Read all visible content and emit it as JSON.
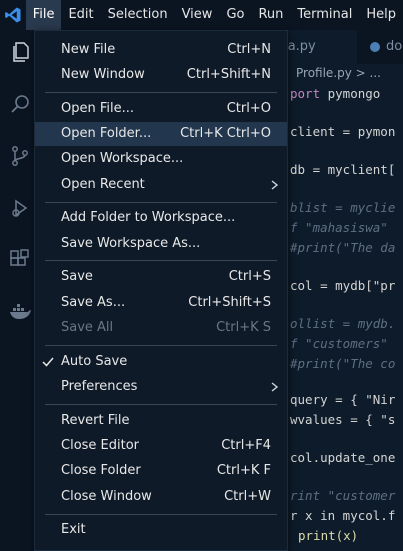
{
  "menubar": {
    "items": [
      "File",
      "Edit",
      "Selection",
      "View",
      "Go",
      "Run",
      "Terminal",
      "Help"
    ],
    "active": "File"
  },
  "tabs": [
    {
      "label": "va.py"
    },
    {
      "label": "doc"
    }
  ],
  "breadcrumb": "Profile.py > ...",
  "editor_lines": [
    {
      "text": "port pymongo"
    },
    {
      "text": "client = pymon"
    },
    {
      "text": "db = myclient["
    },
    {
      "text": "blist = myclie"
    },
    {
      "text": "f \"mahasiswa\""
    },
    {
      "text": "#print(\"The da"
    },
    {
      "text": "col = mydb[\"pr"
    },
    {
      "text": "ollist = mydb."
    },
    {
      "text": "f \"customers\""
    },
    {
      "text": "#print(\"The co"
    },
    {
      "text": "query = { \"Nir"
    },
    {
      "text": "wvalues = { \"s"
    },
    {
      "text": "col.update_one"
    },
    {
      "text": "rint \"customer"
    },
    {
      "text": "r x in mycol.f"
    },
    {
      "text": "print(x)"
    }
  ],
  "file_menu": {
    "groups": [
      [
        {
          "label": "New File",
          "shortcut": "Ctrl+N"
        },
        {
          "label": "New Window",
          "shortcut": "Ctrl+Shift+N"
        }
      ],
      [
        {
          "label": "Open File...",
          "shortcut": "Ctrl+O"
        },
        {
          "label": "Open Folder...",
          "shortcut": "Ctrl+K Ctrl+O"
        },
        {
          "label": "Open Workspace...",
          "shortcut": ""
        },
        {
          "label": "Open Recent",
          "shortcut": ""
        }
      ],
      [
        {
          "label": "Add Folder to Workspace...",
          "shortcut": ""
        },
        {
          "label": "Save Workspace As...",
          "shortcut": ""
        }
      ],
      [
        {
          "label": "Save",
          "shortcut": "Ctrl+S"
        },
        {
          "label": "Save As...",
          "shortcut": "Ctrl+Shift+S"
        },
        {
          "label": "Save All",
          "shortcut": "Ctrl+K S"
        }
      ],
      [
        {
          "label": "Auto Save",
          "shortcut": ""
        },
        {
          "label": "Preferences",
          "shortcut": ""
        }
      ],
      [
        {
          "label": "Revert File",
          "shortcut": ""
        },
        {
          "label": "Close Editor",
          "shortcut": "Ctrl+F4"
        },
        {
          "label": "Close Folder",
          "shortcut": "Ctrl+K F"
        },
        {
          "label": "Close Window",
          "shortcut": "Ctrl+W"
        }
      ],
      [
        {
          "label": "Exit",
          "shortcut": ""
        }
      ]
    ],
    "highlighted": "Open Folder...",
    "disabled": "Save All",
    "checked": "Auto Save",
    "submenus": [
      "Open Recent",
      "Preferences"
    ]
  },
  "colors": {
    "accent": "#3b8eea",
    "menu_bg": "#0e1a28",
    "highlight": "#22364d",
    "editor_bg": "#0d1b2a"
  },
  "icons": [
    "vscode-logo-icon",
    "explorer-icon",
    "search-icon",
    "source-control-icon",
    "run-debug-icon",
    "extensions-icon",
    "docker-icon",
    "checkmark-icon",
    "chevron-right-icon",
    "python-file-icon"
  ]
}
